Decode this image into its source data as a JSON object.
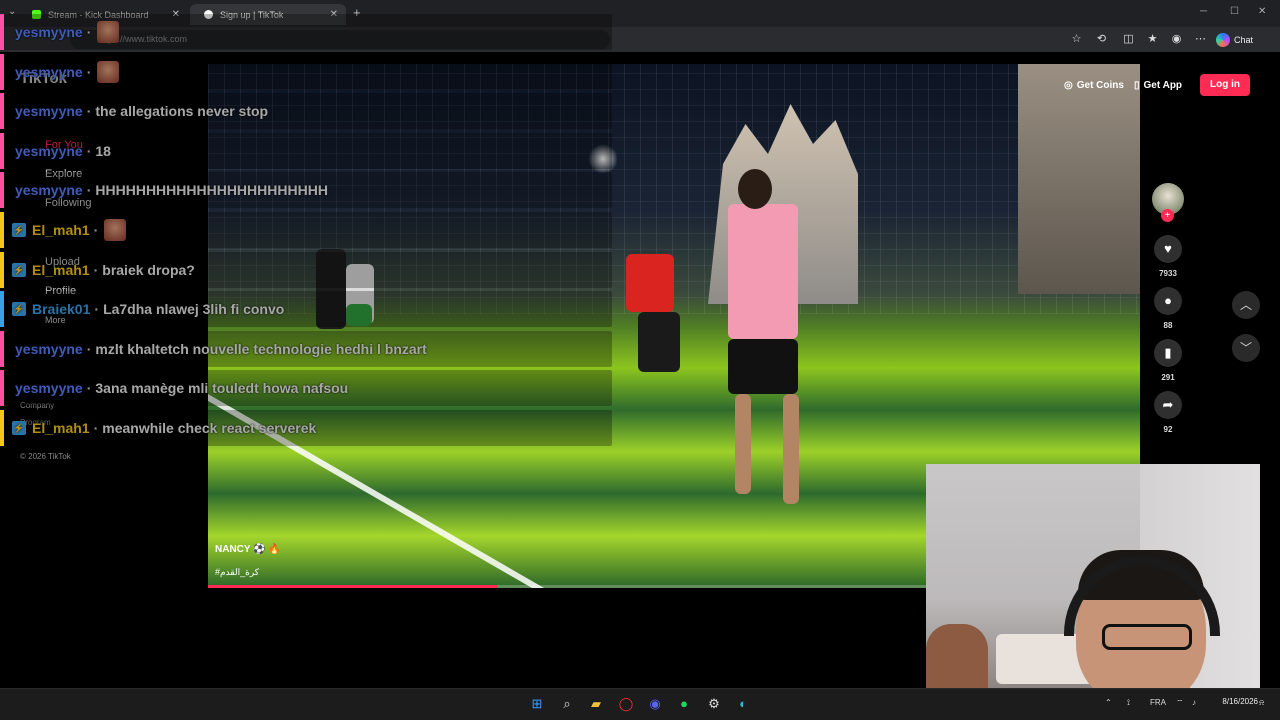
{
  "browser": {
    "tabs": [
      {
        "title": "Stream - Kick Dashboard"
      },
      {
        "title": "Sign up | TikTok"
      }
    ],
    "new_tab": "+",
    "url": "https://www.tiktok.com",
    "chat_label": "Chat"
  },
  "tiktok": {
    "sidebar_ghost": [
      "TikTok",
      "For You",
      "Explore",
      "Following",
      "Upload",
      "Profile",
      "More",
      "Company",
      "Program",
      "© 2026 TikTok"
    ],
    "get_coins": "Get Coins",
    "get_app": "Get App",
    "login": "Log in",
    "video": {
      "author": "NANCY ⚽ 🔥",
      "hashtag": "#كرة_القدم",
      "progress": 0.31
    },
    "rail": {
      "likes": "7933",
      "comments": "88",
      "saves": "291",
      "shares": "92"
    }
  },
  "chat": {
    "colors": {
      "yesmyyne": "#5b7fff",
      "El_mah1": "#f5c518",
      "Braiek01": "#3aa0e8"
    },
    "messages": [
      {
        "user": "yesmyyne",
        "text": "",
        "emote": true,
        "bar": "#ff4fa3"
      },
      {
        "user": "yesmyyne",
        "text": "",
        "emote": true,
        "bar": "#ff4fa3"
      },
      {
        "user": "yesmyyne",
        "text": "the allegations never stop",
        "bar": "#ff4fa3"
      },
      {
        "user": "yesmyyne",
        "text": "18",
        "bar": "#ff4fa3"
      },
      {
        "user": "yesmyyne",
        "text": "HHHHHHHHHHHHHHHHHHHHHHH",
        "bar": "#ff4fa3"
      },
      {
        "user": "El_mah1",
        "text": "",
        "emote": true,
        "badge": true,
        "bar": "#f5c518"
      },
      {
        "user": "El_mah1",
        "text": "braiek dropa?",
        "badge": true,
        "bar": "#f5c518"
      },
      {
        "user": "Braiek01",
        "text": "La7dha nlawej 3lih fi convo",
        "badge": true,
        "bar": "#3aa0e8"
      },
      {
        "user": "yesmyyne",
        "text": "mzlt khaltetch nouvelle technologie hedhi l bnzart",
        "bar": "#ff4fa3"
      },
      {
        "user": "yesmyyne",
        "text": "3ana manège mli touledt howa nafsou",
        "bar": "#ff4fa3"
      },
      {
        "user": "El_mah1",
        "text": "meanwhile check react serverek",
        "badge": true,
        "bar": "#f5c518"
      }
    ]
  },
  "taskbar": {
    "tray_lang": "FRA",
    "date": "8/16/2026"
  }
}
